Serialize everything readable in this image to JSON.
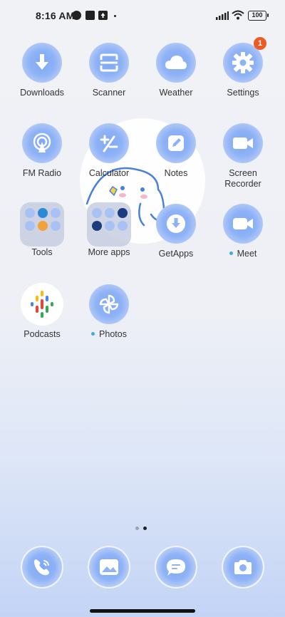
{
  "status": {
    "time": "8:16 AM",
    "battery": "100"
  },
  "apps": [
    {
      "label": "Downloads",
      "icon": "download-icon"
    },
    {
      "label": "Scanner",
      "icon": "scanner-icon"
    },
    {
      "label": "Weather",
      "icon": "cloud-icon"
    },
    {
      "label": "Settings",
      "icon": "gear-icon",
      "badge": "1"
    },
    {
      "label": "FM Radio",
      "icon": "radio-icon"
    },
    {
      "label": "Calculator",
      "icon": "calculator-icon"
    },
    {
      "label": "Notes",
      "icon": "notes-icon"
    },
    {
      "label": "Screen Recorder",
      "icon": "video-camera-icon"
    },
    {
      "label": "Tools",
      "icon": "folder-icon"
    },
    {
      "label": "More apps",
      "icon": "folder-icon"
    },
    {
      "label": "GetApps",
      "icon": "download-icon"
    },
    {
      "label": "Meet",
      "icon": "video-camera-icon",
      "new": true
    },
    {
      "label": "Podcasts",
      "icon": "podcasts-icon"
    },
    {
      "label": "Photos",
      "icon": "pinwheel-icon",
      "new": true
    }
  ],
  "dock": [
    {
      "icon": "phone-icon"
    },
    {
      "icon": "gallery-icon"
    },
    {
      "icon": "messages-icon"
    },
    {
      "icon": "camera-icon"
    }
  ],
  "pager": {
    "pages": 2,
    "active": 2
  },
  "colors": {
    "accent": "#8eb2f6",
    "badge": "#ee5a24",
    "new_dot": "#3fa9e8"
  }
}
